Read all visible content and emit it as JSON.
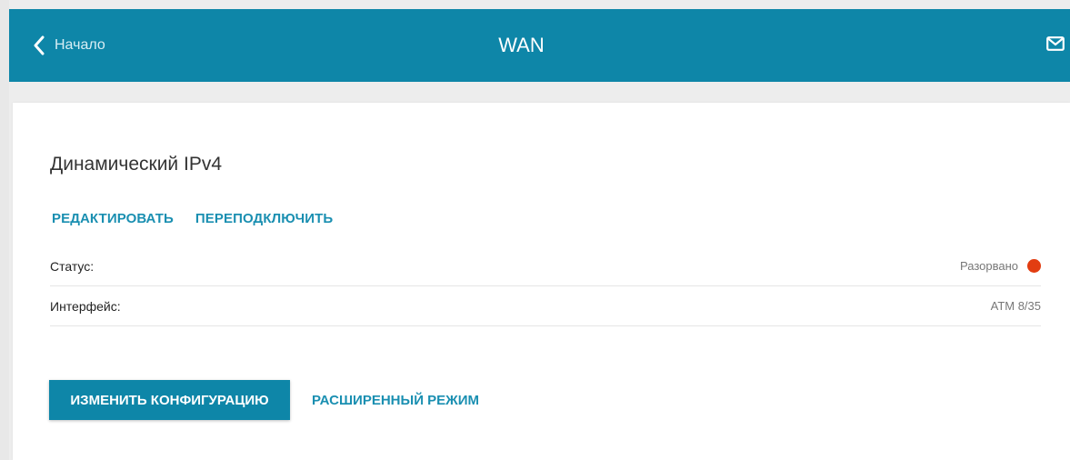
{
  "header": {
    "back_label": "Начало",
    "title": "WAN",
    "back_icon": "chevron-left-icon",
    "mail_icon": "mail-icon"
  },
  "connection": {
    "title": "Динамический IPv4",
    "actions": {
      "edit": "РЕДАКТИРОВАТЬ",
      "reconnect": "ПЕРЕПОДКЛЮЧИТЬ"
    },
    "rows": [
      {
        "label": "Статус:",
        "value": "Разорвано",
        "status_color": "#e23d11"
      },
      {
        "label": "Интерфейс:",
        "value": "ATM 8/35"
      }
    ],
    "buttons": {
      "change_config": "ИЗМЕНИТЬ КОНФИГУРАЦИЮ",
      "advanced_mode": "РАСШИРЕННЫЙ РЕЖИМ"
    }
  },
  "colors": {
    "accent": "#0e86a8",
    "link": "#1a8fb1",
    "background": "#ededed"
  }
}
